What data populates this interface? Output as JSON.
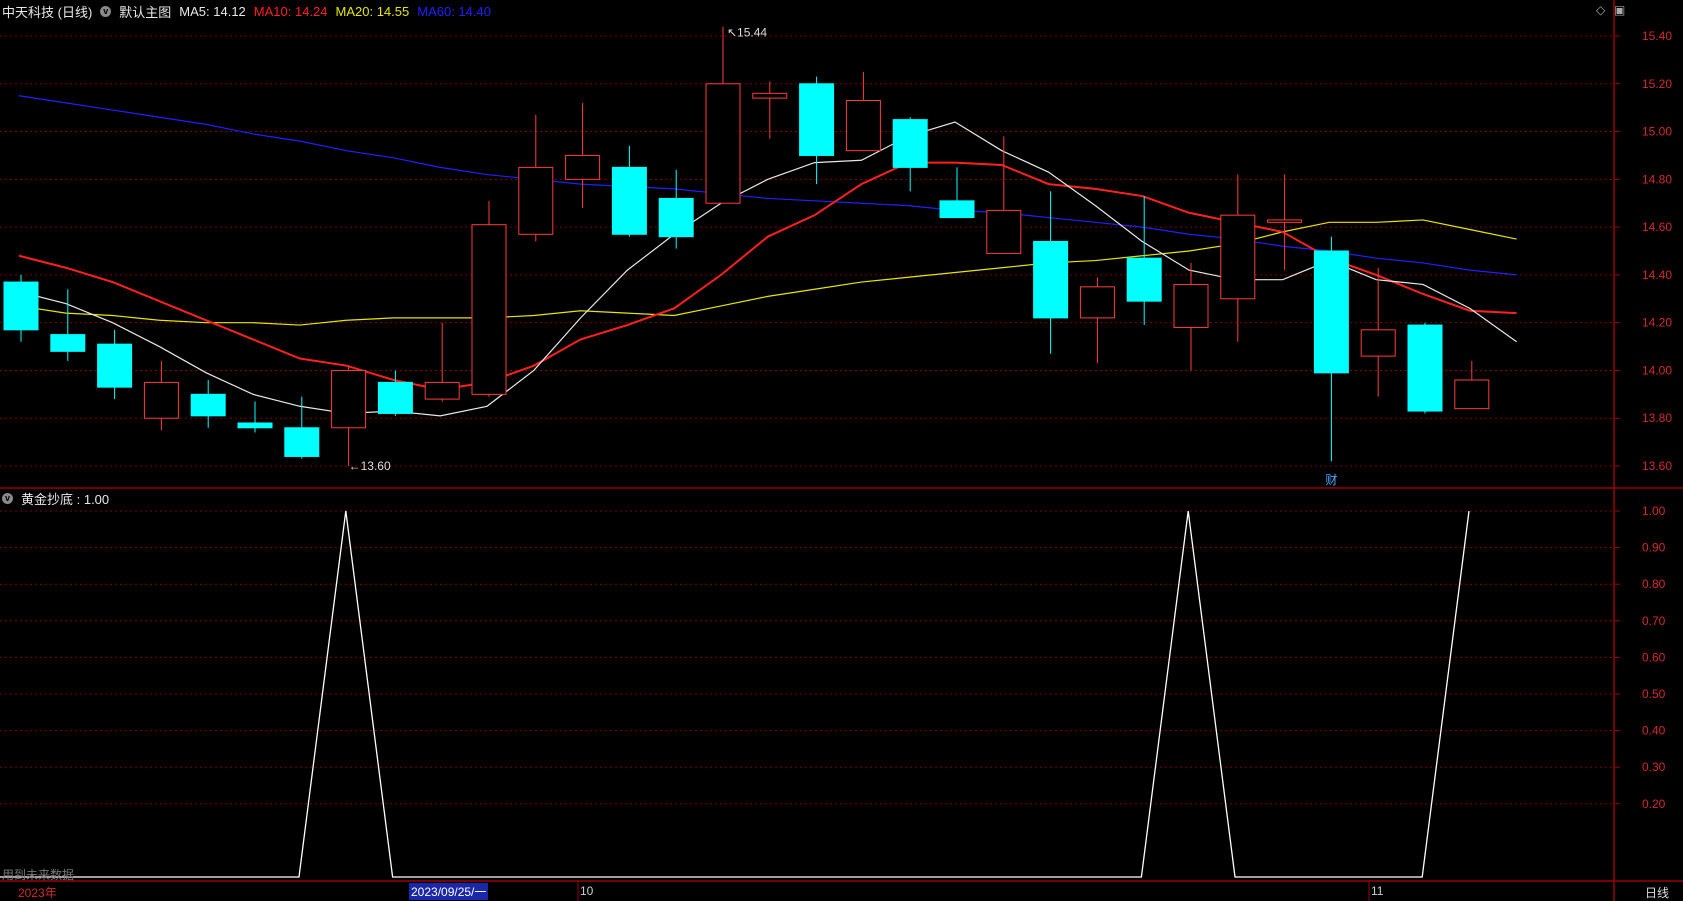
{
  "main": {
    "stock": "中天科技 (日线)",
    "template": "默认主图",
    "ma5": "MA5: 14.12",
    "ma10": "MA10: 14.24",
    "ma20": "MA20: 14.55",
    "ma60": "MA60: 14.40"
  },
  "sub": {
    "indicator": "黄金抄底 : 1.00"
  },
  "notes": {
    "future_data": "用到未来数据",
    "period": "日线",
    "year_label": "2023年",
    "cursor_date": "2023/09/25/一",
    "oct_label": "10",
    "nov_label": "11",
    "high_label": "15.44",
    "low_label": "13.60",
    "event_marker": "财"
  },
  "colors": {
    "up": "#ff3b3b",
    "down": "#00ffff",
    "ma5": "#e8e8e8",
    "ma10": "#ff2020",
    "ma20": "#e6e600",
    "ma60": "#2020ff",
    "grid": "#7a0000",
    "axis": "#9a0000",
    "indicator_line": "#ffffff"
  },
  "chart_data": [
    {
      "type": "candlestick",
      "title": "中天科技 (日线)",
      "ylim": [
        13.5,
        15.5
      ],
      "yticks": [
        13.6,
        13.8,
        14.0,
        14.2,
        14.4,
        14.6,
        14.8,
        15.0,
        15.2,
        15.4
      ],
      "x_labels": [
        "2023年",
        "10",
        "11"
      ],
      "candles": [
        {
          "o": 14.37,
          "h": 14.4,
          "l": 14.12,
          "c": 14.17
        },
        {
          "o": 14.15,
          "h": 14.34,
          "l": 14.04,
          "c": 14.08
        },
        {
          "o": 14.11,
          "h": 14.17,
          "l": 13.88,
          "c": 13.93
        },
        {
          "o": 13.8,
          "h": 14.04,
          "l": 13.75,
          "c": 13.95
        },
        {
          "o": 13.9,
          "h": 13.96,
          "l": 13.76,
          "c": 13.81
        },
        {
          "o": 13.78,
          "h": 13.87,
          "l": 13.74,
          "c": 13.76
        },
        {
          "o": 13.76,
          "h": 13.89,
          "l": 13.63,
          "c": 13.64
        },
        {
          "o": 13.76,
          "h": 14.02,
          "l": 13.6,
          "c": 14.0
        },
        {
          "o": 13.95,
          "h": 14.0,
          "l": 13.81,
          "c": 13.82
        },
        {
          "o": 13.88,
          "h": 14.2,
          "l": 13.87,
          "c": 13.95
        },
        {
          "o": 13.9,
          "h": 14.71,
          "l": 13.89,
          "c": 14.61
        },
        {
          "o": 14.57,
          "h": 15.07,
          "l": 14.54,
          "c": 14.85
        },
        {
          "o": 14.8,
          "h": 15.12,
          "l": 14.68,
          "c": 14.9
        },
        {
          "o": 14.85,
          "h": 14.94,
          "l": 14.56,
          "c": 14.57
        },
        {
          "o": 14.72,
          "h": 14.84,
          "l": 14.51,
          "c": 14.56
        },
        {
          "o": 14.7,
          "h": 15.44,
          "l": 14.7,
          "c": 15.2
        },
        {
          "o": 15.14,
          "h": 15.21,
          "l": 14.97,
          "c": 15.16
        },
        {
          "o": 15.2,
          "h": 15.23,
          "l": 14.78,
          "c": 14.9
        },
        {
          "o": 14.92,
          "h": 15.25,
          "l": 14.92,
          "c": 15.13
        },
        {
          "o": 15.05,
          "h": 15.06,
          "l": 14.75,
          "c": 14.85
        },
        {
          "o": 14.71,
          "h": 14.85,
          "l": 14.64,
          "c": 14.64
        },
        {
          "o": 14.49,
          "h": 14.98,
          "l": 14.49,
          "c": 14.67
        },
        {
          "o": 14.54,
          "h": 14.75,
          "l": 14.07,
          "c": 14.22
        },
        {
          "o": 14.22,
          "h": 14.39,
          "l": 14.03,
          "c": 14.35
        },
        {
          "o": 14.47,
          "h": 14.73,
          "l": 14.19,
          "c": 14.29
        },
        {
          "o": 14.18,
          "h": 14.45,
          "l": 14.0,
          "c": 14.36
        },
        {
          "o": 14.3,
          "h": 14.82,
          "l": 14.12,
          "c": 14.65
        },
        {
          "o": 14.62,
          "h": 14.82,
          "l": 14.42,
          "c": 14.63
        },
        {
          "o": 14.5,
          "h": 14.56,
          "l": 13.62,
          "c": 13.99
        },
        {
          "o": 14.06,
          "h": 14.43,
          "l": 13.89,
          "c": 14.17
        },
        {
          "o": 14.19,
          "h": 14.2,
          "l": 13.82,
          "c": 13.83
        },
        {
          "o": 13.84,
          "h": 14.04,
          "l": 13.84,
          "c": 13.96
        }
      ],
      "ma5": [
        14.33,
        14.28,
        14.2,
        14.1,
        13.99,
        13.9,
        13.85,
        13.82,
        13.83,
        13.81,
        13.85,
        14.0,
        14.22,
        14.42,
        14.57,
        14.7,
        14.8,
        14.87,
        14.88,
        14.98,
        15.04,
        14.92,
        14.83,
        14.69,
        14.54,
        14.42,
        14.38,
        14.38,
        14.46,
        14.38,
        14.36,
        14.26,
        14.12
      ],
      "ma10": [
        14.48,
        14.43,
        14.37,
        14.29,
        14.21,
        14.13,
        14.05,
        14.02,
        13.96,
        13.92,
        13.95,
        14.02,
        14.13,
        14.19,
        14.26,
        14.4,
        14.56,
        14.65,
        14.78,
        14.87,
        14.87,
        14.86,
        14.78,
        14.76,
        14.73,
        14.66,
        14.62,
        14.58,
        14.47,
        14.4,
        14.32,
        14.25,
        14.24
      ],
      "ma20": [
        14.27,
        14.24,
        14.23,
        14.21,
        14.2,
        14.2,
        14.19,
        14.21,
        14.22,
        14.22,
        14.22,
        14.23,
        14.25,
        14.24,
        14.23,
        14.27,
        14.31,
        14.34,
        14.37,
        14.39,
        14.41,
        14.43,
        14.45,
        14.46,
        14.48,
        14.5,
        14.53,
        14.58,
        14.62,
        14.62,
        14.63,
        14.59,
        14.55
      ],
      "ma60": [
        15.15,
        15.12,
        15.09,
        15.06,
        15.03,
        14.99,
        14.96,
        14.92,
        14.89,
        14.85,
        14.82,
        14.8,
        14.78,
        14.77,
        14.76,
        14.74,
        14.72,
        14.71,
        14.7,
        14.69,
        14.67,
        14.66,
        14.64,
        14.62,
        14.6,
        14.57,
        14.55,
        14.52,
        14.5,
        14.47,
        14.45,
        14.42,
        14.4
      ]
    },
    {
      "type": "line",
      "title": "黄金抄底",
      "ylim": [
        0,
        1.05
      ],
      "yticks": [
        0.2,
        0.3,
        0.4,
        0.5,
        0.6,
        0.7,
        0.8,
        0.9,
        1.0
      ],
      "series": [
        {
          "name": "黄金抄底",
          "values": [
            0,
            0,
            0,
            0,
            0,
            0,
            0,
            1,
            0,
            0,
            0,
            0,
            0,
            0,
            0,
            0,
            0,
            0,
            0,
            0,
            0,
            0,
            0,
            0,
            0,
            1,
            0,
            0,
            0,
            0,
            0,
            1
          ]
        }
      ]
    }
  ]
}
